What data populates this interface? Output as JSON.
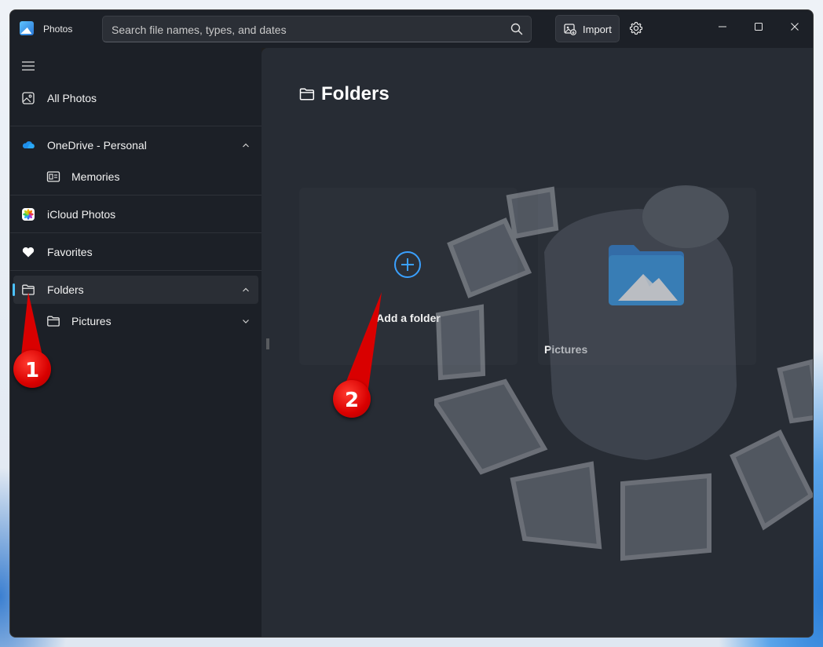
{
  "app": {
    "title": "Photos"
  },
  "search": {
    "placeholder": "Search file names, types, and dates"
  },
  "toolbar": {
    "import_label": "Import"
  },
  "sidebar": {
    "items": [
      {
        "label": "All Photos",
        "icon": "image-icon"
      },
      {
        "label": "OneDrive - Personal",
        "icon": "cloud-icon",
        "expanded": true
      },
      {
        "label": "Memories",
        "icon": "memories-icon"
      },
      {
        "label": "iCloud Photos",
        "icon": "icloud-photos-icon"
      },
      {
        "label": "Favorites",
        "icon": "heart-icon"
      },
      {
        "label": "Folders",
        "icon": "folder-icon",
        "selected": true,
        "expanded": true
      },
      {
        "label": "Pictures",
        "icon": "folder-icon",
        "expanded": false
      }
    ]
  },
  "main": {
    "title": "Folders",
    "cards": [
      {
        "label": "Add a folder",
        "icon": "add-circle-icon"
      },
      {
        "label": "Pictures",
        "icon": "pictures-folder-icon"
      }
    ]
  },
  "annotations": [
    {
      "number": "1"
    },
    {
      "number": "2"
    }
  ],
  "colors": {
    "accent": "#4cc2ff",
    "window_bg": "#1c2027",
    "main_bg": "#272c34",
    "callout_red": "#d90000",
    "folder_blue": "#1e90e8"
  }
}
